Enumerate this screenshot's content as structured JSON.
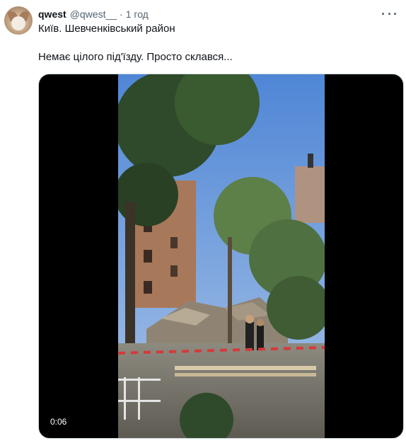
{
  "tweet": {
    "author": {
      "display_name": "qwest",
      "handle": "@qwest__",
      "separator": "·",
      "timestamp": "1 год"
    },
    "text_lines": [
      "Київ. Шевченківський район",
      "Немає цілого під'їзду. Просто склався..."
    ],
    "media": {
      "type": "video",
      "duration": "0:06"
    },
    "icons": {
      "avatar": "cat-avatar",
      "more": "more-icon"
    }
  }
}
